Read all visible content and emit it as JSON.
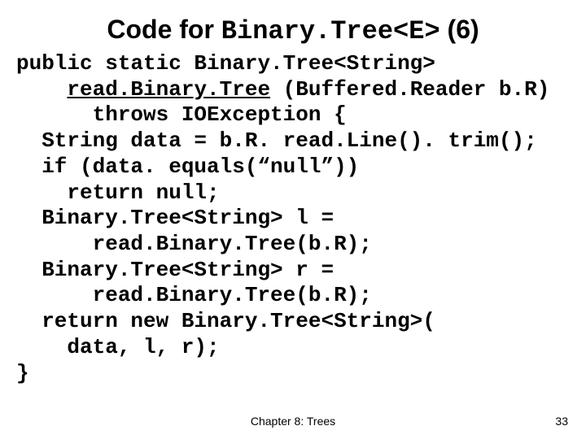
{
  "title": {
    "prefix": "Code for ",
    "mono": "Binary.Tree<E>",
    "suffix": " (6)"
  },
  "code": {
    "l1a": "public static Binary.Tree<String>",
    "l2a": "    ",
    "l2u": "read.Binary.Tree",
    "l2b": " (Buffered.Reader b.R)",
    "l3": "      throws IOException {",
    "l4": "  String data = b.R. read.Line(). trim();",
    "l5": "  if (data. equals(“null”))",
    "l6": "    return null;",
    "l7": "  Binary.Tree<String> l =",
    "l8": "      read.Binary.Tree(b.R);",
    "l9": "  Binary.Tree<String> r =",
    "l10": "      read.Binary.Tree(b.R);",
    "l11": "  return new Binary.Tree<String>(",
    "l12": "    data, l, r);",
    "l13": "}"
  },
  "footer": {
    "chapter": "Chapter 8: Trees",
    "page": "33"
  }
}
